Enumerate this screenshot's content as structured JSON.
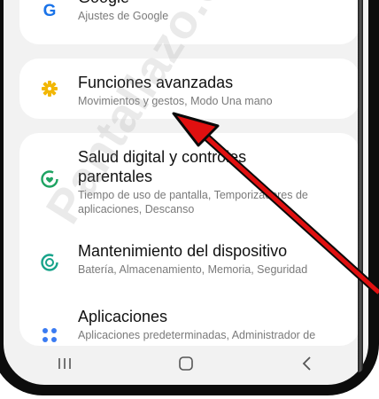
{
  "settings": {
    "items": [
      {
        "title": "Google",
        "subtitle": "Ajustes de Google",
        "icon": "google-icon"
      },
      {
        "title": "Funciones avanzadas",
        "subtitle": "Movimientos y gestos, Modo Una mano",
        "icon": "advanced-features-icon"
      },
      {
        "title": "Salud digital y controles parentales",
        "subtitle": "Tiempo de uso de pantalla, Temporizadores de aplicaciones, Descanso",
        "icon": "digital-wellbeing-icon"
      },
      {
        "title": "Mantenimiento del dispositivo",
        "subtitle": "Batería, Almacenamiento, Memoria, Seguridad",
        "icon": "device-care-icon"
      },
      {
        "title": "Aplicaciones",
        "subtitle": "Aplicaciones predeterminadas, Administrador de",
        "icon": "apps-icon"
      }
    ]
  },
  "watermark": "Pantallazo.es",
  "colors": {
    "google_blue": "#1a73e8",
    "advanced_yellow": "#f2b705",
    "wellbeing_green": "#1ea362",
    "care_teal": "#17a38a",
    "apps_blue": "#3a7bf2",
    "arrow_red": "#e01010"
  }
}
